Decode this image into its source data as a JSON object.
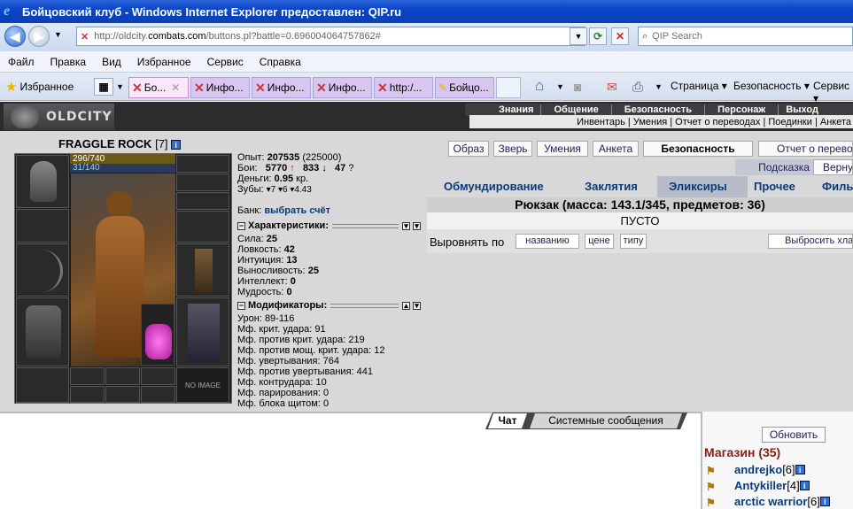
{
  "window": {
    "title": "Бойцовский клуб - Windows Internet Explorer предоставлен: QIP.ru"
  },
  "address": {
    "url_prefix": "http://oldcity.",
    "url_domain": "combats.com",
    "url_suffix": "/buttons.pl?battle=0.696004064757862#",
    "search_placeholder": "QIP Search"
  },
  "menu": [
    "Файл",
    "Правка",
    "Вид",
    "Избранное",
    "Сервис",
    "Справка"
  ],
  "favorites_label": "Избранное",
  "tabs": [
    {
      "label": "Бо..."
    },
    {
      "label": "Инфо..."
    },
    {
      "label": "Инфо..."
    },
    {
      "label": "Инфо..."
    },
    {
      "label": "http:/..."
    },
    {
      "label": "Бойцо..."
    }
  ],
  "toolbar": {
    "page": "Страница",
    "security": "Безопасность",
    "service": "Сервис"
  },
  "game": {
    "logo": "OLDCITY",
    "topmenu": [
      "Знания",
      "Общение",
      "Безопасность",
      "Персонаж",
      "Выход"
    ],
    "submenu": "Инвентарь | Умения | Отчет о переводах | Поединки | Анкета",
    "nick": "FRAGGLE ROCK",
    "level": "[7]",
    "hp": "296/740",
    "mp": "31/140",
    "no_image": "NO IMAGE",
    "stats": {
      "exp_label": "Опыт:",
      "exp": "207535",
      "exp_next": "(225000)",
      "fights_label": "Бои:",
      "wins": "5770",
      "losses": "833",
      "draws": "47",
      "money_label": "Деньги:",
      "money": "0.95",
      "money_unit": "кр.",
      "teeth_label": "Зубы:",
      "teeth": "▾7 ▾6 ▾4.43",
      "bank_label": "Банк:",
      "bank_link": "выбрать счёт"
    },
    "char_title": "Характеристики:",
    "chars": [
      {
        "k": "Сила:",
        "v": "25"
      },
      {
        "k": "Ловкость:",
        "v": "42"
      },
      {
        "k": "Интуиция:",
        "v": "13"
      },
      {
        "k": "Выносливость:",
        "v": "25"
      },
      {
        "k": "Интеллект:",
        "v": "0"
      },
      {
        "k": "Мудрость:",
        "v": "0"
      }
    ],
    "mod_title": "Модификаторы:",
    "mods": [
      {
        "k": "Урон:",
        "v": "89-116"
      },
      {
        "k": "Мф. крит. удара:",
        "v": "91"
      },
      {
        "k": "Мф. против крит. удара:",
        "v": "219"
      },
      {
        "k": "Мф. против мощ. крит. удара:",
        "v": "12"
      },
      {
        "k": "Мф. увертывания:",
        "v": "764"
      },
      {
        "k": "Мф. против увертывания:",
        "v": "441"
      },
      {
        "k": "Мф. контрудара:",
        "v": "10"
      },
      {
        "k": "Мф. парирования:",
        "v": "0"
      },
      {
        "k": "Мф. блока щитом:",
        "v": "0"
      }
    ],
    "buttons": [
      "Образ",
      "Зверь",
      "Умения",
      "Анкета",
      "Безопасность",
      "Отчет о переводах"
    ],
    "hint": "Подсказка",
    "back": "Вернуться",
    "inv_tabs": [
      "Обмундирование",
      "Заклятия",
      "Эликсиры",
      "Прочее",
      "Фильтр"
    ],
    "rukzak": "Рюкзак (масса: 143.1/345, предметов: 36)",
    "empty": "ПУСТО",
    "align_label": "Выровнять по",
    "align_buttons": [
      "названию",
      "цене",
      "типу"
    ],
    "drop_all": "Выбросить хлам"
  },
  "chat": {
    "tab_chat": "Чат",
    "tab_system": "Системные сообщения"
  },
  "right": {
    "refresh": "Обновить",
    "room": "Магазин (35)",
    "players": [
      {
        "name": "andrejko",
        "level": "[6]"
      },
      {
        "name": "Antykiller",
        "level": "[4]"
      },
      {
        "name": "arctic warrior",
        "level": "[6]"
      }
    ]
  }
}
